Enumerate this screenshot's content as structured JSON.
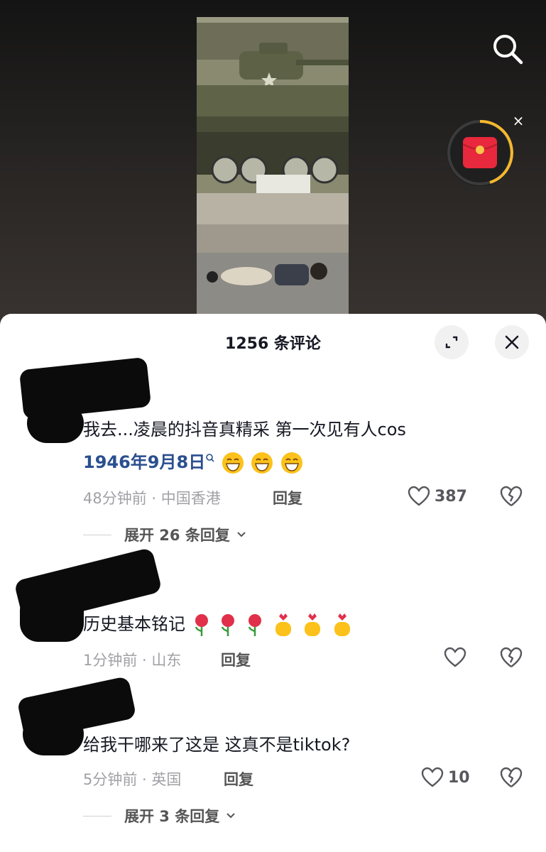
{
  "header": {
    "comment_count_title": "1256 条评论"
  },
  "icons": {
    "search": "search-icon",
    "red_packet": "red-packet-icon",
    "close_packet": "close-icon",
    "expand": "expand-icon",
    "close_sheet": "close-icon",
    "like": "heart-outline-icon",
    "dislike": "broken-heart-icon"
  },
  "redpacket": {
    "close_label": "×"
  },
  "comments": [
    {
      "text_line1": "我去...凌晨的抖音真精采 第一次见有人cos",
      "link_text": "1946年9月8日",
      "time_location": "48分钟前 · 中国香港",
      "reply_label": "回复",
      "likes": "387",
      "expand_replies": "展开 26 条回复"
    },
    {
      "text_line1": "历史基本铭记",
      "time_location": "1分钟前 · 山东",
      "reply_label": "回复",
      "likes": ""
    },
    {
      "text_line1": "给我干哪来了这是 这真不是tiktok?",
      "time_location": "5分钟前 · 英国",
      "reply_label": "回复",
      "likes": "10",
      "expand_replies": "展开 3 条回复"
    }
  ],
  "colors": {
    "accent_link": "#2a4f8f",
    "packet_red": "#e8283c",
    "packet_ring": "#f5b82e"
  }
}
